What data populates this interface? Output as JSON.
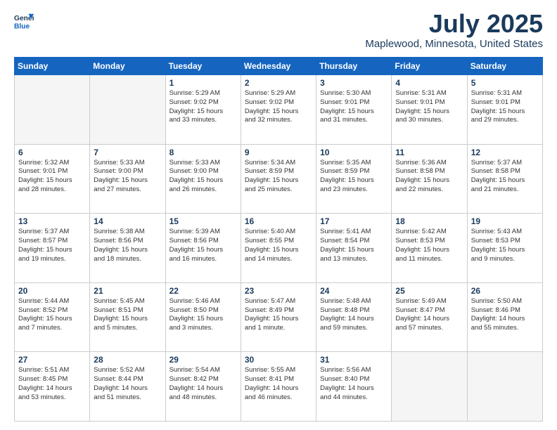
{
  "header": {
    "logo_line1": "General",
    "logo_line2": "Blue",
    "month": "July 2025",
    "location": "Maplewood, Minnesota, United States"
  },
  "weekdays": [
    "Sunday",
    "Monday",
    "Tuesday",
    "Wednesday",
    "Thursday",
    "Friday",
    "Saturday"
  ],
  "weeks": [
    [
      {
        "day": "",
        "info": ""
      },
      {
        "day": "",
        "info": ""
      },
      {
        "day": "1",
        "info": "Sunrise: 5:29 AM\nSunset: 9:02 PM\nDaylight: 15 hours\nand 33 minutes."
      },
      {
        "day": "2",
        "info": "Sunrise: 5:29 AM\nSunset: 9:02 PM\nDaylight: 15 hours\nand 32 minutes."
      },
      {
        "day": "3",
        "info": "Sunrise: 5:30 AM\nSunset: 9:01 PM\nDaylight: 15 hours\nand 31 minutes."
      },
      {
        "day": "4",
        "info": "Sunrise: 5:31 AM\nSunset: 9:01 PM\nDaylight: 15 hours\nand 30 minutes."
      },
      {
        "day": "5",
        "info": "Sunrise: 5:31 AM\nSunset: 9:01 PM\nDaylight: 15 hours\nand 29 minutes."
      }
    ],
    [
      {
        "day": "6",
        "info": "Sunrise: 5:32 AM\nSunset: 9:01 PM\nDaylight: 15 hours\nand 28 minutes."
      },
      {
        "day": "7",
        "info": "Sunrise: 5:33 AM\nSunset: 9:00 PM\nDaylight: 15 hours\nand 27 minutes."
      },
      {
        "day": "8",
        "info": "Sunrise: 5:33 AM\nSunset: 9:00 PM\nDaylight: 15 hours\nand 26 minutes."
      },
      {
        "day": "9",
        "info": "Sunrise: 5:34 AM\nSunset: 8:59 PM\nDaylight: 15 hours\nand 25 minutes."
      },
      {
        "day": "10",
        "info": "Sunrise: 5:35 AM\nSunset: 8:59 PM\nDaylight: 15 hours\nand 23 minutes."
      },
      {
        "day": "11",
        "info": "Sunrise: 5:36 AM\nSunset: 8:58 PM\nDaylight: 15 hours\nand 22 minutes."
      },
      {
        "day": "12",
        "info": "Sunrise: 5:37 AM\nSunset: 8:58 PM\nDaylight: 15 hours\nand 21 minutes."
      }
    ],
    [
      {
        "day": "13",
        "info": "Sunrise: 5:37 AM\nSunset: 8:57 PM\nDaylight: 15 hours\nand 19 minutes."
      },
      {
        "day": "14",
        "info": "Sunrise: 5:38 AM\nSunset: 8:56 PM\nDaylight: 15 hours\nand 18 minutes."
      },
      {
        "day": "15",
        "info": "Sunrise: 5:39 AM\nSunset: 8:56 PM\nDaylight: 15 hours\nand 16 minutes."
      },
      {
        "day": "16",
        "info": "Sunrise: 5:40 AM\nSunset: 8:55 PM\nDaylight: 15 hours\nand 14 minutes."
      },
      {
        "day": "17",
        "info": "Sunrise: 5:41 AM\nSunset: 8:54 PM\nDaylight: 15 hours\nand 13 minutes."
      },
      {
        "day": "18",
        "info": "Sunrise: 5:42 AM\nSunset: 8:53 PM\nDaylight: 15 hours\nand 11 minutes."
      },
      {
        "day": "19",
        "info": "Sunrise: 5:43 AM\nSunset: 8:53 PM\nDaylight: 15 hours\nand 9 minutes."
      }
    ],
    [
      {
        "day": "20",
        "info": "Sunrise: 5:44 AM\nSunset: 8:52 PM\nDaylight: 15 hours\nand 7 minutes."
      },
      {
        "day": "21",
        "info": "Sunrise: 5:45 AM\nSunset: 8:51 PM\nDaylight: 15 hours\nand 5 minutes."
      },
      {
        "day": "22",
        "info": "Sunrise: 5:46 AM\nSunset: 8:50 PM\nDaylight: 15 hours\nand 3 minutes."
      },
      {
        "day": "23",
        "info": "Sunrise: 5:47 AM\nSunset: 8:49 PM\nDaylight: 15 hours\nand 1 minute."
      },
      {
        "day": "24",
        "info": "Sunrise: 5:48 AM\nSunset: 8:48 PM\nDaylight: 14 hours\nand 59 minutes."
      },
      {
        "day": "25",
        "info": "Sunrise: 5:49 AM\nSunset: 8:47 PM\nDaylight: 14 hours\nand 57 minutes."
      },
      {
        "day": "26",
        "info": "Sunrise: 5:50 AM\nSunset: 8:46 PM\nDaylight: 14 hours\nand 55 minutes."
      }
    ],
    [
      {
        "day": "27",
        "info": "Sunrise: 5:51 AM\nSunset: 8:45 PM\nDaylight: 14 hours\nand 53 minutes."
      },
      {
        "day": "28",
        "info": "Sunrise: 5:52 AM\nSunset: 8:44 PM\nDaylight: 14 hours\nand 51 minutes."
      },
      {
        "day": "29",
        "info": "Sunrise: 5:54 AM\nSunset: 8:42 PM\nDaylight: 14 hours\nand 48 minutes."
      },
      {
        "day": "30",
        "info": "Sunrise: 5:55 AM\nSunset: 8:41 PM\nDaylight: 14 hours\nand 46 minutes."
      },
      {
        "day": "31",
        "info": "Sunrise: 5:56 AM\nSunset: 8:40 PM\nDaylight: 14 hours\nand 44 minutes."
      },
      {
        "day": "",
        "info": ""
      },
      {
        "day": "",
        "info": ""
      }
    ]
  ]
}
